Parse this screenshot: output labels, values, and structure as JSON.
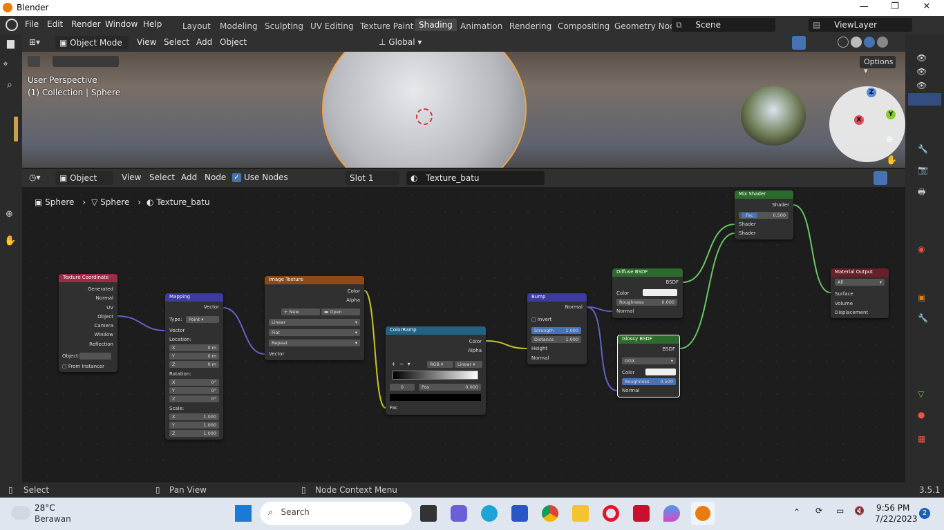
{
  "window": {
    "title": "Blender"
  },
  "menu": [
    "File",
    "Edit",
    "Render",
    "Window",
    "Help"
  ],
  "workspaces": [
    "Layout",
    "Modeling",
    "Sculpting",
    "UV Editing",
    "Texture Paint",
    "Shading",
    "Animation",
    "Rendering",
    "Compositing",
    "Geometry Noc"
  ],
  "active_workspace": "Shading",
  "scene": {
    "name": "Scene",
    "view_layer": "ViewLayer"
  },
  "viewport": {
    "mode": "Object Mode",
    "menus": [
      "View",
      "Select",
      "Add",
      "Object"
    ],
    "transform": "Global",
    "options": "Options",
    "overlay_text1": "User Perspective",
    "overlay_text2": "(1) Collection | Sphere"
  },
  "node_editor": {
    "type": "Object",
    "menus": [
      "View",
      "Select",
      "Add",
      "Node"
    ],
    "use_nodes_label": "Use Nodes",
    "use_nodes_checked": true,
    "slot": "Slot 1",
    "material": "Texture_batu",
    "breadcrumb": [
      "Sphere",
      "Sphere",
      "Texture_batu"
    ]
  },
  "nodes": {
    "texcoord": {
      "title": "Texture Coordinate",
      "outputs": [
        "Generated",
        "Normal",
        "UV",
        "Object",
        "Camera",
        "Window",
        "Reflection"
      ],
      "object_label": "Object:",
      "from_instancer": "From Instancer"
    },
    "mapping": {
      "title": "Mapping",
      "output": "Vector",
      "type_label": "Type:",
      "type_value": "Point",
      "input": "Vector",
      "location_label": "Location:",
      "location": [
        [
          "X",
          "0 m"
        ],
        [
          "Y",
          "0 m"
        ],
        [
          "Z",
          "0 m"
        ]
      ],
      "rotation_label": "Rotation:",
      "rotation": [
        [
          "X",
          "0°"
        ],
        [
          "Y",
          "0°"
        ],
        [
          "Z",
          "0°"
        ]
      ],
      "scale_label": "Scale:",
      "scale": [
        [
          "X",
          "1.000"
        ],
        [
          "Y",
          "1.000"
        ],
        [
          "Z",
          "1.000"
        ]
      ]
    },
    "image": {
      "title": "Image Texture",
      "outputs": [
        "Color",
        "Alpha"
      ],
      "new": "New",
      "open": "Open",
      "interp": "Linear",
      "proj": "Flat",
      "ext": "Repeat",
      "input": "Vector"
    },
    "ramp": {
      "title": "ColorRamp",
      "outputs": [
        "Color",
        "Alpha"
      ],
      "mode": "RGB",
      "interp": "Linear",
      "index": "0",
      "pos_label": "Pos",
      "pos": "0.000",
      "input": "Fac"
    },
    "bump": {
      "title": "Bump",
      "output": "Normal",
      "invert": "Invert",
      "strength_label": "Strength",
      "strength": "1.000",
      "distance_label": "Distance",
      "distance": "1.000",
      "inputs": [
        "Height",
        "Normal"
      ]
    },
    "diffuse": {
      "title": "Diffuse BSDF",
      "output": "BSDF",
      "color": "Color",
      "roughness_label": "Roughness",
      "roughness": "0.000",
      "normal": "Normal"
    },
    "glossy": {
      "title": "Glossy BSDF",
      "output": "BSDF",
      "dist": "GGX",
      "color": "Color",
      "roughness_label": "Roughness",
      "roughness": "0.500",
      "normal": "Normal"
    },
    "mix": {
      "title": "Mix Shader",
      "output": "Shader",
      "fac_label": "Fac",
      "fac": "0.500",
      "inputs": [
        "Shader",
        "Shader"
      ]
    },
    "output": {
      "title": "Material Output",
      "target": "All",
      "inputs": [
        "Surface",
        "Volume",
        "Displacement"
      ]
    }
  },
  "statusbar": {
    "select": "Select",
    "pan": "Pan View",
    "context": "Node Context Menu",
    "version": "3.5.1"
  },
  "taskbar": {
    "temp": "28°C",
    "weather": "Berawan",
    "search": "Search",
    "time": "9:56 PM",
    "date": "7/22/2023",
    "badge": "2"
  },
  "colors": {
    "accent": "#4772b3",
    "orange": "#e87d0d",
    "header_texcoord": "#9d2b47",
    "header_vector": "#3c3ca0",
    "header_texture": "#8a4a1a",
    "header_converter": "#246283",
    "header_shader": "#2d6b2d",
    "header_output": "#6b1f2b"
  }
}
